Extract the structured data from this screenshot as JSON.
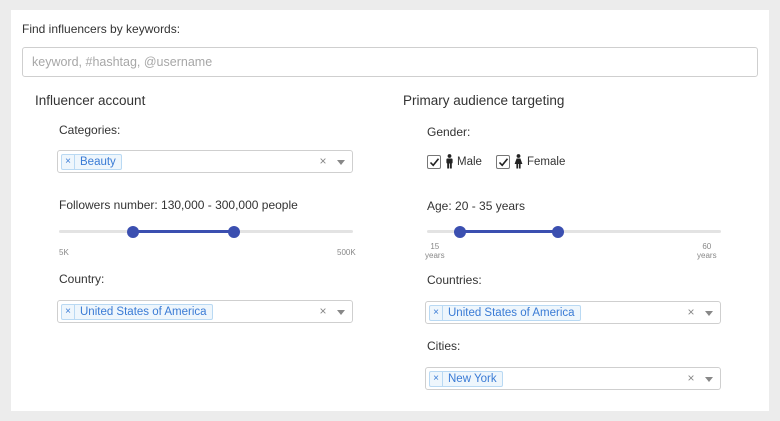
{
  "search": {
    "label": "Find influencers by keywords:",
    "placeholder": "keyword, #hashtag, @username",
    "value": ""
  },
  "influencer": {
    "title": "Influencer account",
    "categories": {
      "label": "Categories:",
      "tag": "Beauty"
    },
    "followers": {
      "label": "Followers number: 130,000 - 300,000 people",
      "min_label": "5K",
      "max_label": "500K",
      "range_min": 5000,
      "range_max": 500000,
      "low": 130000,
      "high": 300000
    },
    "country": {
      "label": "Country:",
      "tag": "United States of America"
    }
  },
  "audience": {
    "title": "Primary audience targeting",
    "gender": {
      "label": "Gender:",
      "male": {
        "label": "Male",
        "checked": true
      },
      "female": {
        "label": "Female",
        "checked": true
      }
    },
    "age": {
      "label": "Age: 20 - 35 years",
      "min_label": "15",
      "min_unit": "years",
      "max_label": "60",
      "max_unit": "years",
      "range_min": 15,
      "range_max": 60,
      "low": 20,
      "high": 35
    },
    "countries": {
      "label": "Countries:",
      "tag": "United States of America"
    },
    "cities": {
      "label": "Cities:",
      "tag": "New York"
    }
  },
  "colors": {
    "accent": "#3b4fb0",
    "tag_text": "#3a7bd5",
    "tag_bg": "#eef6fc",
    "page_bg": "#ececec"
  },
  "icons": {
    "tag_remove": "×",
    "clear": "×",
    "dropdown": "chevron-down-icon",
    "male": "male-icon",
    "female": "female-icon",
    "check": "check-icon"
  }
}
